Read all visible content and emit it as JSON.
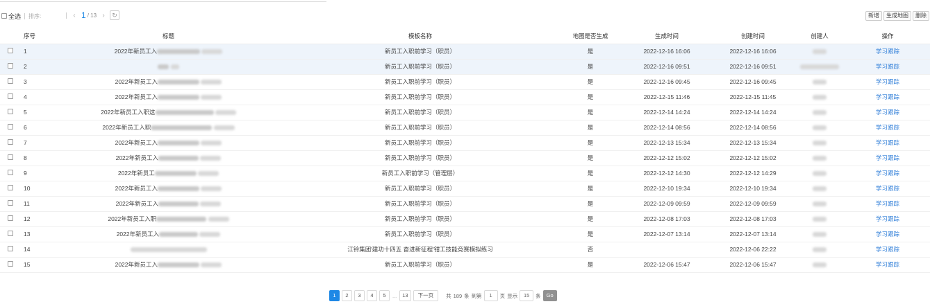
{
  "toolbar": {
    "select_all": "全选",
    "sort_label": "排序:",
    "prev_icon": "‹",
    "next_icon": "›",
    "current_page": "1",
    "total_pages": "/ 13",
    "refresh_icon": "↻",
    "add_label": "新增",
    "generate_map_label": "生成地图",
    "delete_label": "删除"
  },
  "table": {
    "headers": {
      "no": "序号",
      "title": "标题",
      "template": "模板名称",
      "map_generated": "地图是否生成",
      "generate_time": "生成时间",
      "create_time": "创建时间",
      "creator": "创建人",
      "action": "操作"
    },
    "rows": [
      {
        "no": "1",
        "title": "2022年新员工入",
        "template": "新员工入职前学习（职员）",
        "map": "是",
        "gen": "2022-12-16 16:06",
        "created": "2022-12-16 16:06",
        "action": "学习跟踪"
      },
      {
        "no": "2",
        "title": "",
        "template": "新员工入职前学习（职员）",
        "map": "是",
        "gen": "2022-12-16 09:51",
        "created": "2022-12-16 09:51",
        "action": "学习跟踪"
      },
      {
        "no": "3",
        "title": "2022年新员工入",
        "template": "新员工入职前学习（职员）",
        "map": "是",
        "gen": "2022-12-16 09:45",
        "created": "2022-12-16 09:45",
        "action": "学习跟踪"
      },
      {
        "no": "4",
        "title": "2022年新员工入",
        "template": "新员工入职前学习（职员）",
        "map": "是",
        "gen": "2022-12-15 11:46",
        "created": "2022-12-15 11:45",
        "action": "学习跟踪"
      },
      {
        "no": "5",
        "title": "2022年新员工入职这",
        "template": "新员工入职前学习（职员）",
        "map": "是",
        "gen": "2022-12-14 14:24",
        "created": "2022-12-14 14:24",
        "action": "学习跟踪"
      },
      {
        "no": "6",
        "title": "2022年新员工入职",
        "template": "新员工入职前学习（职员）",
        "map": "是",
        "gen": "2022-12-14 08:56",
        "created": "2022-12-14 08:56",
        "action": "学习跟踪"
      },
      {
        "no": "7",
        "title": "2022年新员工入",
        "template": "新员工入职前学习（职员）",
        "map": "是",
        "gen": "2022-12-13 15:34",
        "created": "2022-12-13 15:34",
        "action": "学习跟踪"
      },
      {
        "no": "8",
        "title": "2022年新员工入",
        "template": "新员工入职前学习（职员）",
        "map": "是",
        "gen": "2022-12-12 15:02",
        "created": "2022-12-12 15:02",
        "action": "学习跟踪"
      },
      {
        "no": "9",
        "title": "2022年新员工",
        "template": "新员工入职前学习（管理层）",
        "map": "是",
        "gen": "2022-12-12 14:30",
        "created": "2022-12-12 14:29",
        "action": "学习跟踪"
      },
      {
        "no": "10",
        "title": "2022年新员工入",
        "template": "新员工入职前学习（职员）",
        "map": "是",
        "gen": "2022-12-10 19:34",
        "created": "2022-12-10 19:34",
        "action": "学习跟踪"
      },
      {
        "no": "11",
        "title": "2022年新员工入",
        "template": "新员工入职前学习（职员）",
        "map": "是",
        "gen": "2022-12-09 09:59",
        "created": "2022-12-09 09:59",
        "action": "学习跟踪"
      },
      {
        "no": "12",
        "title": "2022年新员工入职",
        "template": "新员工入职前学习（职员）",
        "map": "是",
        "gen": "2022-12-08 17:03",
        "created": "2022-12-08 17:03",
        "action": "学习跟踪"
      },
      {
        "no": "13",
        "title": "2022年新员工入",
        "template": "新员工入职前学习（职员）",
        "map": "是",
        "gen": "2022-12-07 13:14",
        "created": "2022-12-07 13:14",
        "action": "学习跟踪"
      },
      {
        "no": "14",
        "title": "",
        "template": "江铃集团'建功十四五 奋进新征程'钳工技能竞赛模拟练习",
        "map": "否",
        "gen": "",
        "created": "2022-12-06 22:22",
        "action": "学习跟踪"
      },
      {
        "no": "15",
        "title": "2022年新员工入",
        "template": "新员工入职前学习（职员）",
        "map": "是",
        "gen": "2022-12-06 15:47",
        "created": "2022-12-06 15:47",
        "action": "学习跟踪"
      }
    ]
  },
  "pagination": {
    "pages": [
      "1",
      "2",
      "3",
      "4",
      "5"
    ],
    "ellipsis": "...",
    "last_page": "13",
    "next_label": "下一页",
    "total_prefix": "共",
    "total_count": "189",
    "total_suffix": "条",
    "goto_label": "到第",
    "goto_value": "1",
    "page_unit": "页",
    "show_label": "显示",
    "page_size": "15",
    "size_unit": "条",
    "go_label": "Go"
  }
}
